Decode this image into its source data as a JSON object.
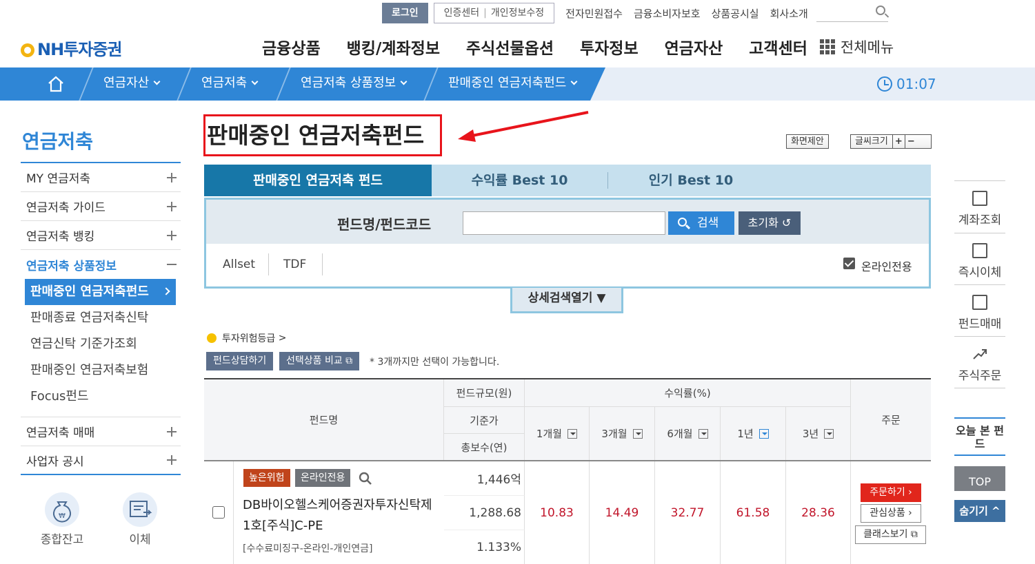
{
  "util": {
    "login": "로그인",
    "cert": "인증센터",
    "privacy": "개인정보수정",
    "links": [
      "전자민원접수",
      "금융소비자보호",
      "상품공시실",
      "회사소개"
    ]
  },
  "logo": "NH투자증권",
  "gnb": [
    "금융상품",
    "뱅킹/계좌정보",
    "주식선물옵션",
    "투자정보",
    "연금자산",
    "고객센터"
  ],
  "all_menu": "전체메뉴",
  "breadcrumb": [
    "연금자산",
    "연금저축",
    "연금저축 상품정보",
    "판매중인 연금저축펀드"
  ],
  "timer": "01:07",
  "lnb": {
    "title": "연금저축",
    "items": [
      "MY 연금저축",
      "연금저축 가이드",
      "연금저축 뱅킹",
      "연금저축 상품정보"
    ],
    "sub": [
      "판매중인 연금저축펀드",
      "판매종료 연금저축신탁",
      "연금신탁 기준가조회",
      "판매중인 연금저축보험",
      "Focus펀드"
    ],
    "items2": [
      "연금저축 매매",
      "사업자 공시"
    ],
    "quick": [
      "종합잔고",
      "이체"
    ]
  },
  "page": {
    "title": "판매중인 연금저축펀드",
    "suggest": "화면제안",
    "font_size": "글씨크기",
    "plus": "+",
    "minus": "−"
  },
  "tabs": [
    "판매중인 연금저축 펀드",
    "수익률 Best 10",
    "인기 Best 10"
  ],
  "search": {
    "label": "펀드명/펀드코드",
    "value": "",
    "button": "검색",
    "reset": "초기화",
    "chips": [
      "Allset",
      "TDF"
    ],
    "online_only": "온라인전용",
    "more": "상세검색열기"
  },
  "grade": "투자위험등급",
  "actions": {
    "consult": "펀드상담하기",
    "compare": "선택상품 비교",
    "note": "* 3개까지만 선택이 가능합니다."
  },
  "table": {
    "h_name": "펀드명",
    "h_size": "펀드규모(원)",
    "h_base": "기준가",
    "h_fee": "총보수(연)",
    "h_return": "수익률(%)",
    "periods": [
      "1개월",
      "3개월",
      "6개월",
      "1년",
      "3년"
    ],
    "h_order": "주문",
    "rows": [
      {
        "badges": [
          "높은위험",
          "온라인전용"
        ],
        "name": "DB바이오헬스케어증권자투자신탁제1호[주식]C-PE",
        "sub": "[수수료미징구-온라인-개인연금]",
        "size": "1,446억",
        "base": "1,288.68",
        "fee": "1.133%",
        "returns": [
          "10.83",
          "14.49",
          "32.77",
          "61.58",
          "28.36"
        ],
        "order": "주문하기",
        "interest": "관심상품",
        "class": "클래스보기"
      }
    ]
  },
  "right": {
    "items": [
      "계좌조회",
      "즉시이체",
      "펀드매매",
      "주식주문"
    ],
    "today": "오늘 본 펀드",
    "top": "TOP",
    "hide": "숨기기"
  },
  "colors": {
    "primary": "#2f86d6",
    "tab_active": "#1777a8",
    "highlight": "#e8141b",
    "return": "#c1152a"
  }
}
